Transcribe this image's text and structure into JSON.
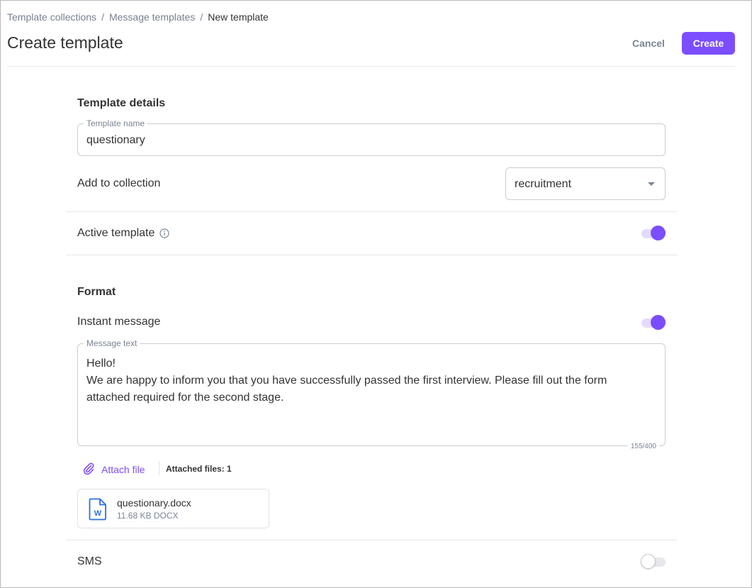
{
  "breadcrumb": {
    "items": [
      "Template collections",
      "Message templates",
      "New template"
    ],
    "separator": "/"
  },
  "header": {
    "title": "Create template",
    "cancel_label": "Cancel",
    "create_label": "Create"
  },
  "details": {
    "heading": "Template details",
    "template_name_label": "Template name",
    "template_name_value": "questionary",
    "collection_label": "Add to collection",
    "collection_value": "recruitment",
    "active_label": "Active template",
    "active_on": true
  },
  "format": {
    "heading": "Format",
    "instant_label": "Instant message",
    "instant_on": true,
    "message_label": "Message text",
    "message_value": "Hello!\nWe are happy to inform you that you have successfully passed the first interview. Please fill out the form attached required for the second stage.",
    "char_count": "155/400",
    "attach_label": "Attach file",
    "attached_count": "Attached files: 1",
    "file": {
      "name": "questionary.docx",
      "meta": "11.68 KB DOCX",
      "icon_letter": "W"
    },
    "sms_label": "SMS",
    "sms_on": false
  },
  "colors": {
    "accent": "#7c4dff",
    "text": "#333333",
    "muted": "#7a8494",
    "border": "#c9cdd3"
  },
  "icons": {
    "info": "info-icon",
    "attach": "paperclip-icon",
    "file": "word-document-icon",
    "dropdown": "caret-down-icon"
  }
}
